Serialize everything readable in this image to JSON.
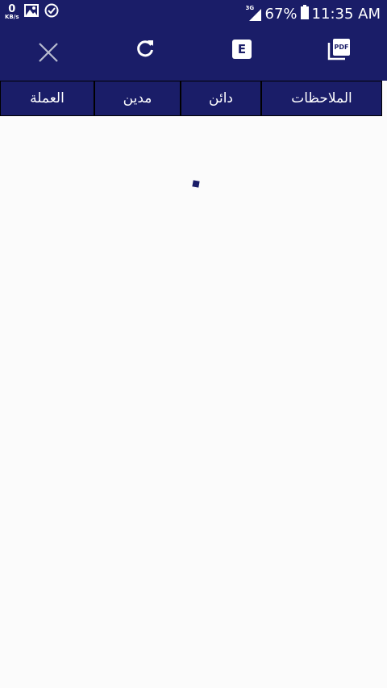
{
  "statusbar": {
    "net_speed": "0",
    "net_unit": "KB/s",
    "network_type": "3G",
    "battery": "67%",
    "time": "11:35 AM"
  },
  "toolbar": {
    "pdf_label": "PDF",
    "excel_label": "E"
  },
  "table": {
    "headers": [
      "العملة",
      "مدين",
      "دائن",
      "الملاحظات"
    ]
  },
  "colors": {
    "primary": "#1a1d68",
    "background": "#fbfbfb"
  }
}
